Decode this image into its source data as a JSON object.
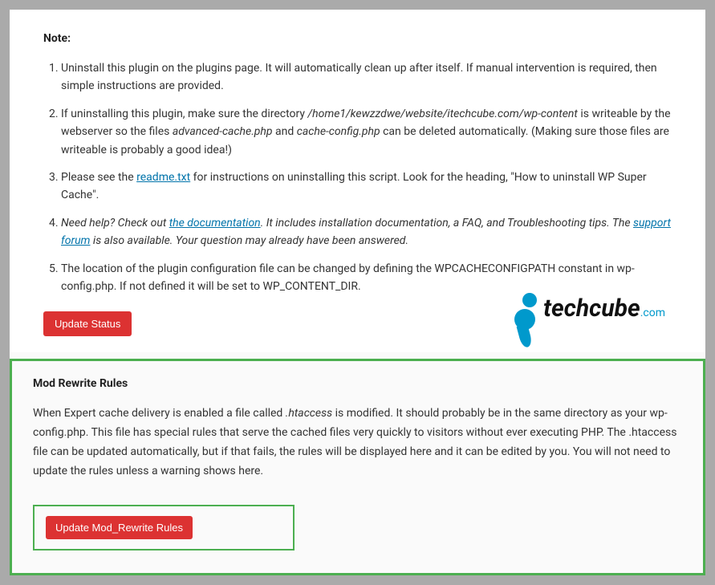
{
  "note": {
    "heading": "Note:",
    "items": [
      {
        "text": "Uninstall this plugin on the plugins page. It will automatically clean up after itself. If manual intervention is required, then simple instructions are provided."
      },
      {
        "prefix": "If uninstalling this plugin, make sure the directory ",
        "italic1": "/home1/kewzzdwe/website/itechcube.com/wp-content",
        "mid1": " is writeable by the webserver so the files ",
        "italic2": "advanced-cache.php",
        "mid2": " and ",
        "italic3": "cache-config.php",
        "suffix": " can be deleted automatically. (Making sure those files are writeable is probably a good idea!)"
      },
      {
        "prefix": "Please see the ",
        "link": "readme.txt",
        "suffix": " for instructions on uninstalling this script. Look for the heading, \"How to uninstall WP Super Cache\"."
      },
      {
        "italic_prefix": "Need help? Check out ",
        "link1": "the documentation",
        "italic_mid1": ". It includes installation documentation, a FAQ, and Troubleshooting tips. The ",
        "link2": "support forum",
        "italic_suffix": " is also available. Your question may already have been answered."
      },
      {
        "text": "The location of the plugin configuration file can be changed by defining the WPCACHECONFIGPATH constant in wp-config.php. If not defined it will be set to WP_CONTENT_DIR."
      }
    ],
    "update_status_btn": "Update Status"
  },
  "logo": {
    "text": "techcube",
    "suffix": ".com"
  },
  "mod_rewrite": {
    "heading": "Mod Rewrite Rules",
    "text_prefix": "When Expert cache delivery is enabled a file called ",
    "text_italic": ".htaccess",
    "text_suffix": " is modified. It should probably be in the same directory as your wp-config.php. This file has special rules that serve the cached files very quickly to visitors without ever executing PHP. The .htaccess file can be updated automatically, but if that fails, the rules will be displayed here and it can be edited by you. You will not need to update the rules unless a warning shows here.",
    "update_btn": "Update Mod_Rewrite Rules"
  }
}
